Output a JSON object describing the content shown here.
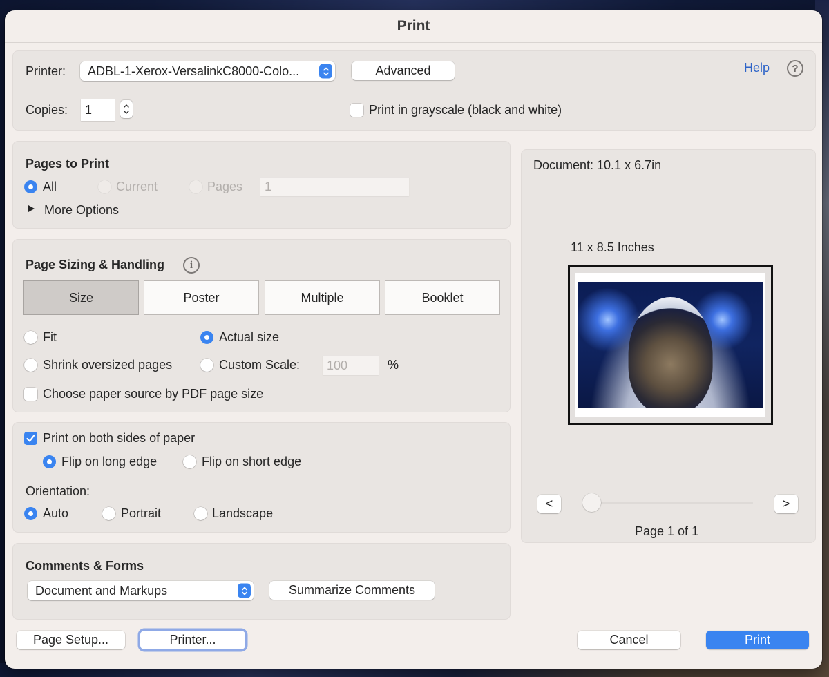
{
  "dialog": {
    "title": "Print"
  },
  "printer_section": {
    "printer_label": "Printer:",
    "printer_value": "ADBL-1-Xerox-VersalinkC8000-Colo...",
    "advanced_label": "Advanced",
    "help_label": "Help",
    "help_icon": "?",
    "copies_label": "Copies:",
    "copies_value": "1",
    "grayscale_label": "Print in grayscale (black and white)",
    "grayscale_checked": false
  },
  "pages_to_print": {
    "title": "Pages to Print",
    "options": [
      {
        "label": "All",
        "selected": true,
        "enabled": true
      },
      {
        "label": "Current",
        "selected": false,
        "enabled": false
      },
      {
        "label": "Pages",
        "selected": false,
        "enabled": false
      }
    ],
    "pages_value": "1",
    "more_options_label": "More Options"
  },
  "page_sizing": {
    "title": "Page Sizing & Handling",
    "info_icon": "i",
    "tabs": [
      {
        "label": "Size",
        "active": true
      },
      {
        "label": "Poster",
        "active": false
      },
      {
        "label": "Multiple",
        "active": false
      },
      {
        "label": "Booklet",
        "active": false
      }
    ],
    "fit_label": "Fit",
    "actual_size_label": "Actual size",
    "shrink_label": "Shrink oversized pages",
    "custom_scale_label": "Custom Scale:",
    "custom_scale_value": "100",
    "percent_label": "%",
    "selected_option": "Actual size",
    "paper_source_label": "Choose paper source by PDF page size",
    "paper_source_checked": false
  },
  "duplex": {
    "both_sides_label": "Print on both sides of paper",
    "both_sides_checked": true,
    "flip_long_label": "Flip on long edge",
    "flip_short_label": "Flip on short edge",
    "selected_flip": "Flip on long edge",
    "orientation_label": "Orientation:",
    "orientation_options": [
      "Auto",
      "Portrait",
      "Landscape"
    ],
    "selected_orientation": "Auto"
  },
  "comments_forms": {
    "title": "Comments & Forms",
    "select_value": "Document and Markups",
    "summarize_label": "Summarize Comments"
  },
  "preview": {
    "document_size": "Document: 10.1 x 6.7in",
    "paper_size": "11 x 8.5 Inches",
    "image_description": "astronaut cat in space",
    "prev_label": "<",
    "next_label": ">",
    "page_indicator": "Page 1 of 1",
    "current_page": 1,
    "total_pages": 1
  },
  "footer": {
    "page_setup_label": "Page Setup...",
    "printer_label": "Printer...",
    "cancel_label": "Cancel",
    "print_label": "Print"
  },
  "colors": {
    "accent": "#3a84f0",
    "dialog_bg": "#f3eeeb",
    "group_bg": "#e9e5e2",
    "link": "#2e64c8"
  }
}
